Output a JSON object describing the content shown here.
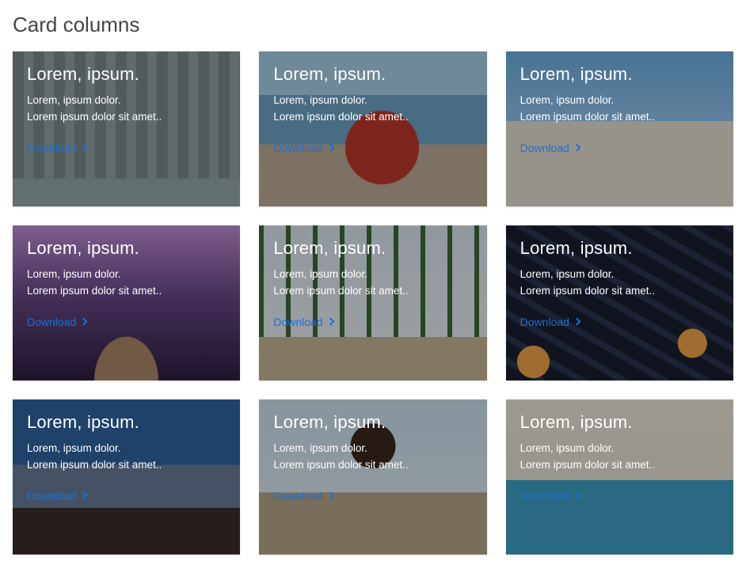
{
  "page": {
    "heading": "Card columns"
  },
  "card_defaults": {
    "title": "Lorem, ipsum.",
    "line1": "Lorem, ipsum dolor.",
    "line2": "Lorem ipsum dolor sit amet..",
    "link_label": "Download"
  },
  "cards": [
    {
      "bg_class": "bg1"
    },
    {
      "bg_class": "bg2"
    },
    {
      "bg_class": "bg3"
    },
    {
      "bg_class": "bg4"
    },
    {
      "bg_class": "bg5"
    },
    {
      "bg_class": "bg6"
    },
    {
      "bg_class": "bg7"
    },
    {
      "bg_class": "bg8"
    },
    {
      "bg_class": "bg9"
    }
  ]
}
